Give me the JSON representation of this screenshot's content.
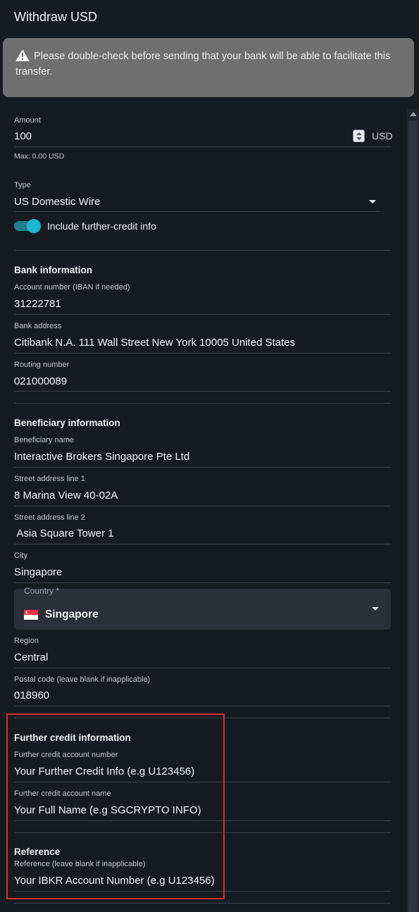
{
  "header": {
    "title": "Withdraw USD"
  },
  "alert": {
    "icon": "warning-icon",
    "text": "Please double-check before sending that your bank will be able to facilitate this transfer."
  },
  "amount": {
    "label": "Amount",
    "value": "100",
    "currency": "USD",
    "max": "Max: 0.00 USD"
  },
  "type": {
    "label": "Type",
    "value": "US Domestic Wire"
  },
  "further_credit_toggle": {
    "label": "Include further-credit info",
    "checked": true
  },
  "bank": {
    "section_title": "Bank information",
    "account_number": {
      "label": "Account number (IBAN if needed)",
      "value": "31222781"
    },
    "bank_address": {
      "label": "Bank address",
      "value": "Citibank N.A. 111 Wall Street New York 10005 United States"
    },
    "routing_number": {
      "label": "Routing number",
      "value": "021000089"
    }
  },
  "beneficiary": {
    "section_title": "Beneficiary information",
    "name": {
      "label": "Beneficiary name",
      "value": "Interactive Brokers Singapore Pte Ltd"
    },
    "street1": {
      "label": "Street address line 1",
      "value": "8 Marina View 40-02A"
    },
    "street2": {
      "label": "Street address line 2",
      "value": " Asia Square Tower 1"
    },
    "city": {
      "label": "City",
      "value": "Singapore"
    },
    "country": {
      "label": "Country *",
      "value": "Singapore",
      "flag": "singapore-flag-icon"
    },
    "region": {
      "label": "Region",
      "value": "Central"
    },
    "postal_code": {
      "label": "Postal code (leave blank if inapplicable)",
      "value": "018960"
    }
  },
  "further_credit": {
    "section_title": "Further credit information",
    "account_number": {
      "label": "Further credit account number",
      "value": "Your Further Credit Info (e.g U123456)"
    },
    "account_name": {
      "label": "Further credit account name",
      "value": "Your Full Name (e.g SGCRYPTO INFO)"
    }
  },
  "reference": {
    "section_title": "Reference",
    "field": {
      "label": "Reference (leave blank if inapplicable)",
      "value": "Your IBKR Account Number (e.g U123456)"
    }
  },
  "colors": {
    "accent": "#1fb7cf",
    "highlight": "#d62f2f",
    "background": "#161b22",
    "alert": "#6e6f6e"
  }
}
